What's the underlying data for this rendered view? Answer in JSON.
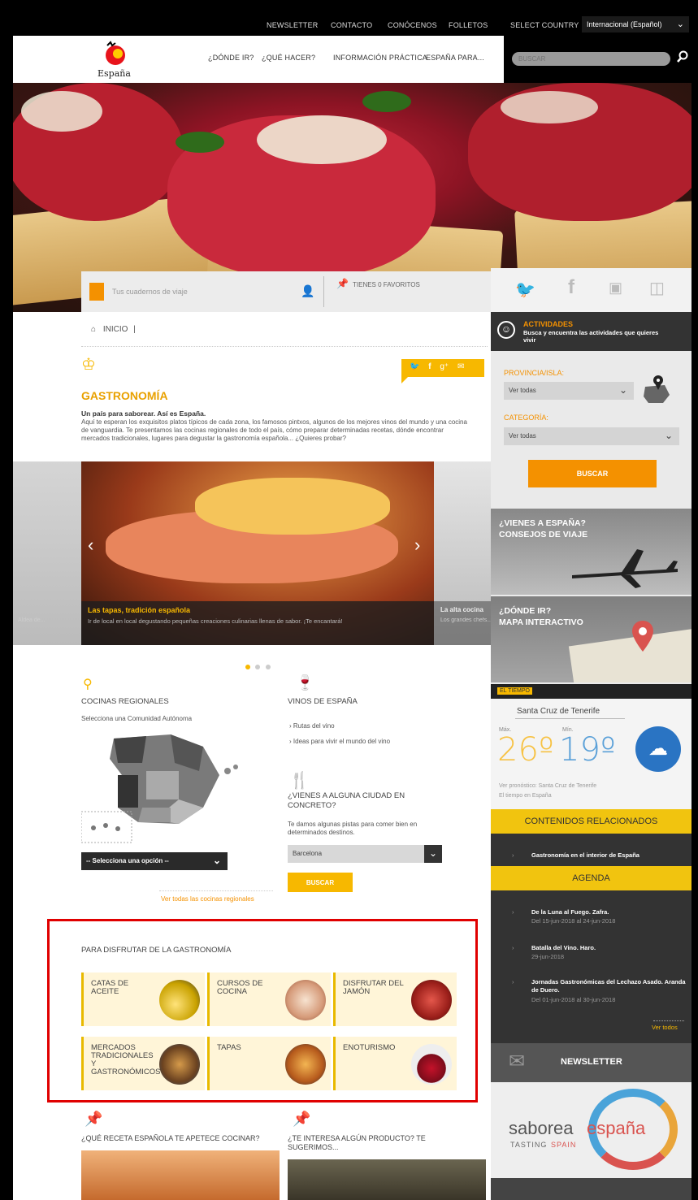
{
  "topbar": {
    "links": [
      "NEWSLETTER",
      "CONTACTO",
      "CONÓCENOS",
      "FOLLETOS"
    ],
    "country_label": "SELECT COUNTRY",
    "country_value": "Internacional (Español)"
  },
  "header": {
    "logo_text": "España",
    "nav": [
      "¿DÓNDE IR?",
      "¿QUÉ HACER?",
      "INFORMACIÓN PRÁCTICA",
      "ESPAÑA PARA..."
    ],
    "search_placeholder": "BUSCAR"
  },
  "journal": {
    "label": "Tus cuadernos de viaje",
    "favorites": "TIENES 0 FAVORITOS"
  },
  "breadcrumb": {
    "home": "INICIO"
  },
  "page": {
    "title": "GASTRONOMÍA",
    "lead": "Un país para saborear. Así es España.",
    "body": "Aquí te esperan los exquisitos platos típicos de cada zona, los famosos pintxos, algunos de los mejores vinos del mundo y una cocina de vanguardia. Te presentamos las cocinas regionales de todo el país, cómo preparar determinadas recetas, dónde encontrar mercados tradicionales, lugares para degustar la gastronomía española... ¿Quieres probar?"
  },
  "share": {
    "icons": [
      "twitter-icon",
      "facebook-icon",
      "googleplus-icon",
      "email-icon"
    ]
  },
  "slider": {
    "left_caption": "Aldea de...",
    "caption_title": "Las tapas, tradición española",
    "caption_text": "Ir de local en local degustando pequeñas creaciones culinarias llenas de sabor. ¡Te encantará!",
    "right_caption_title": "La alta cocina",
    "right_caption_text": "Los grandes chefs..."
  },
  "regional": {
    "title": "COCINAS REGIONALES",
    "subtitle": "Selecciona una Comunidad Autónoma",
    "select": "-- Selecciona una opción --",
    "see_all": "Ver todas las cocinas regionales"
  },
  "wines": {
    "title": "VINOS DE ESPAÑA",
    "links": [
      "Rutas del vino",
      "Ideas para vivir el mundo del vino"
    ]
  },
  "city": {
    "title": "¿VIENES A ALGUNA CIUDAD EN CONCRETO?",
    "text": "Te damos algunas pistas para comer bien en determinados destinos.",
    "select": "Barcelona",
    "button": "BUSCAR"
  },
  "enjoy": {
    "title": "PARA DISFRUTAR DE LA GASTRONOMÍA",
    "tiles": [
      {
        "label": "CATAS DE ACEITE"
      },
      {
        "label": "CURSOS DE COCINA"
      },
      {
        "label": "DISFRUTAR DEL JAMÓN"
      },
      {
        "label": "MERCADOS TRADICIONALES Y GASTRONÓMICOS"
      },
      {
        "label": "TAPAS"
      },
      {
        "label": "ENOTURISMO"
      }
    ]
  },
  "bottom": {
    "recipe_title": "¿QUÉ RECETA ESPAÑOLA TE APETECE COCINAR?",
    "product_title": "¿TE INTERESA ALGÚN PRODUCTO? TE SUGERIMOS..."
  },
  "activities": {
    "title": "ACTIVIDADES",
    "subtitle": "Busca y encuentra las actividades que quieres vivir",
    "province_label": "PROVINCIA/ISLA:",
    "province_value": "Ver todas",
    "category_label": "CATEGORÍA:",
    "category_value": "Ver todas",
    "button": "BUSCAR"
  },
  "promo1": {
    "line1": "¿VIENES A ESPAÑA?",
    "line2": "CONSEJOS DE VIAJE"
  },
  "promo2": {
    "line1": "¿DÓNDE IR?",
    "line2": "MAPA INTERACTIVO"
  },
  "weather": {
    "tag": "EL TIEMPO",
    "city": "Santa Cruz de Tenerife",
    "max_label": "Máx.",
    "min_label": "Mín.",
    "max": "26º",
    "min": "19º",
    "forecast_link": "Ver pronóstico: Santa Cruz de Tenerife",
    "spain_link": "El tiempo en España"
  },
  "related": {
    "title": "CONTENIDOS RELACIONADOS",
    "items": [
      "Gastronomía en el interior de España"
    ]
  },
  "agenda": {
    "title": "AGENDA",
    "items": [
      {
        "title": "De la Luna al Fuego. Zafra.",
        "date": "Del 15-jun-2018 al 24-jun-2018"
      },
      {
        "title": "Batalla del Vino. Haro.",
        "date": "29-jun-2018"
      },
      {
        "title": "Jornadas Gastronómicas del Lechazo Asado. Aranda de Duero.",
        "date": "Del 01-jun-2018 al 30-jun-2018"
      }
    ],
    "see_all": "Ver todos"
  },
  "newsletter": {
    "title": "NEWSLETTER"
  },
  "saborea": {
    "brand1": "saborea",
    "brand2": "españa",
    "tagline1": "TASTING",
    "tagline2": "SPAIN"
  },
  "colors": {
    "accent": "#f7b800",
    "orange": "#f49100",
    "highlight": "#e00000",
    "dark": "#333333"
  }
}
